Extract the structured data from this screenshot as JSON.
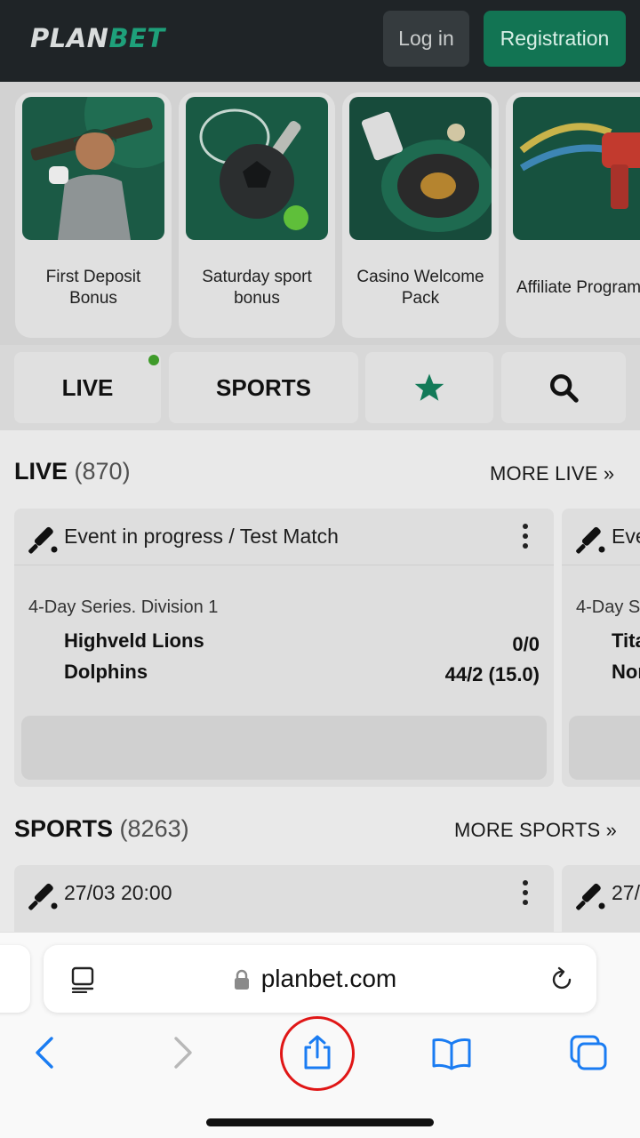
{
  "header": {
    "logo_part1": "PLAN",
    "logo_part2": "BET",
    "login_label": "Log in",
    "registration_label": "Registration"
  },
  "promos": [
    {
      "label": "First Deposit Bonus"
    },
    {
      "label": "Saturday sport bonus"
    },
    {
      "label": "Casino Welcome Pack"
    },
    {
      "label": "Affiliate Program"
    }
  ],
  "nav": {
    "live_label": "LIVE",
    "sports_label": "SPORTS",
    "favorites_icon": "star-icon",
    "search_icon": "search-icon"
  },
  "live_section": {
    "title": "LIVE",
    "count": "(870)",
    "more_label": "MORE LIVE »",
    "card": {
      "title": "Event in progress / Test Match",
      "league": "4-Day Series. Division 1",
      "team1": "Highveld Lions",
      "score1": "0/0",
      "team2": "Dolphins",
      "score2": "44/2 (15.0)"
    },
    "peek_card": {
      "title": "Eve",
      "league": "4-Day S",
      "team1": "Tita",
      "team2": "Nor"
    }
  },
  "sports_section": {
    "title": "SPORTS",
    "count": "(8263)",
    "more_label": "MORE SPORTS »",
    "card": {
      "title": "27/03 20:00"
    },
    "peek_card": {
      "title": "27/"
    }
  },
  "browser": {
    "url": "planbet.com",
    "icons": [
      "reader-icon",
      "lock-icon",
      "reload-icon",
      "back-icon",
      "forward-icon",
      "share-icon",
      "bookmarks-icon",
      "tabs-icon"
    ]
  },
  "colors": {
    "brand_green": "#1ea07a",
    "header_bg": "#1f2427",
    "ios_blue": "#1a7cf2",
    "highlight_red": "#e01616"
  }
}
